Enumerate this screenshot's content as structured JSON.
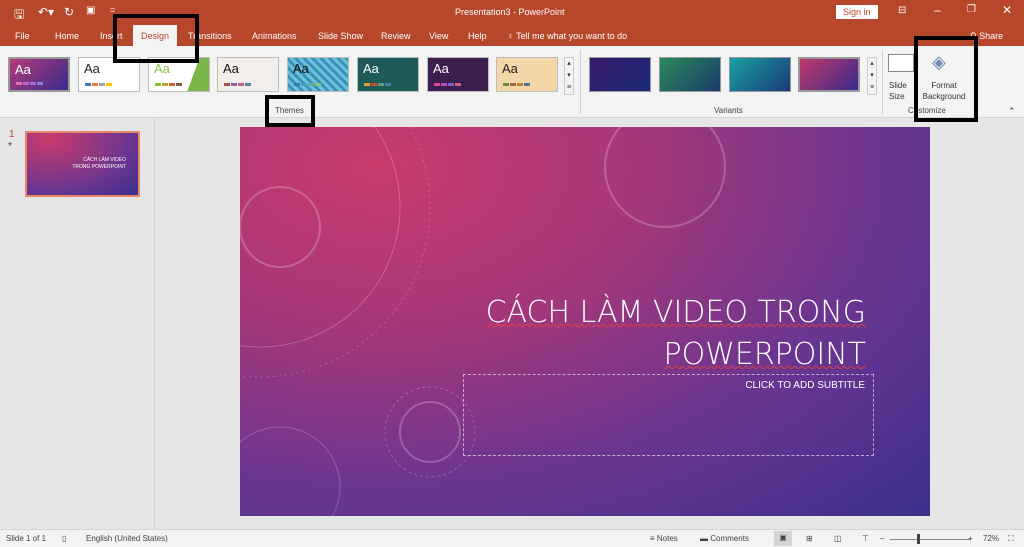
{
  "window": {
    "title": "Presentation3  -  PowerPoint",
    "sign_in": "Sign in"
  },
  "tabs": [
    "File",
    "Home",
    "Insert",
    "Design",
    "Transitions",
    "Animations",
    "Slide Show",
    "Review",
    "View",
    "Help"
  ],
  "tell_me": "Tell me what you want to do",
  "share": "Share",
  "themes": {
    "label": "Themes",
    "aa": "Aa"
  },
  "variants": {
    "label": "Variants"
  },
  "customize": {
    "label": "Customize",
    "slide_size": "Slide Size",
    "format_background": "Format Background"
  },
  "slide_panel": {
    "number": "1",
    "star": "*",
    "thumb_title": "CÁCH LÀM VIDEO TRONG POWERPOINT"
  },
  "slide": {
    "title_line1": "CÁCH LÀM VIDEO TRONG",
    "title_line2": "POWERPOINT",
    "subtitle_placeholder": "CLICK TO ADD SUBTITLE"
  },
  "status": {
    "slide_count": "Slide 1 of 1",
    "language": "English (United States)",
    "notes": "Notes",
    "comments": "Comments",
    "zoom": "72%",
    "zoom_percent": 72
  }
}
